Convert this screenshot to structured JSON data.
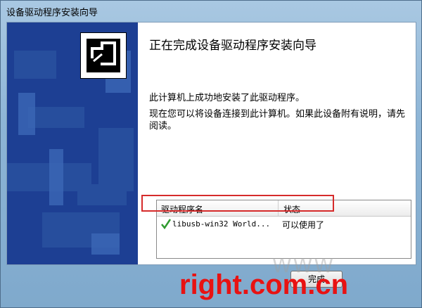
{
  "window": {
    "title": "设备驱动程序安装向导"
  },
  "main": {
    "heading": "正在完成设备驱动程序安装向导",
    "p1": "此计算机上成功地安装了此驱动程序。",
    "p2": "现在您可以将设备连接到此计算机。如果此设备附有说明，请先阅读。"
  },
  "drivers": {
    "headers": [
      "驱动程序名",
      "状态"
    ],
    "rows": [
      {
        "name": "libusb-win32 World...",
        "status": "可以使用了"
      }
    ]
  },
  "footer": {
    "finish_label": "完成"
  },
  "watermark": {
    "text": "right.com.cn",
    "faint": "WWW"
  },
  "colors": {
    "accent": "#1d3f93",
    "highlight": "#d62b2b",
    "watermark": "#e81212"
  }
}
